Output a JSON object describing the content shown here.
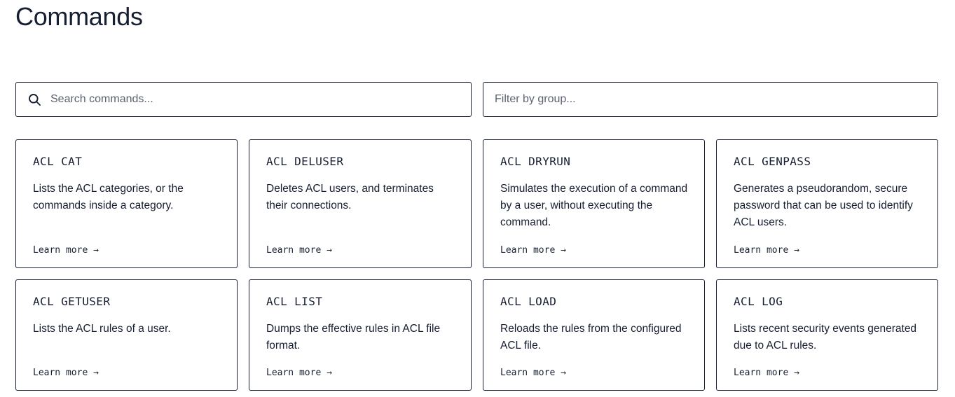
{
  "page": {
    "title": "Commands"
  },
  "search": {
    "commands_placeholder": "Search commands...",
    "group_placeholder": "Filter by group..."
  },
  "icons": {
    "search": "search-icon"
  },
  "colors": {
    "text": "#161f31",
    "border": "#161f31",
    "placeholder": "#5b6270",
    "background": "#ffffff"
  },
  "cards": [
    {
      "title": "ACL CAT",
      "description": "Lists the ACL categories, or the commands inside a category.",
      "link": "Learn more →"
    },
    {
      "title": "ACL DELUSER",
      "description": "Deletes ACL users, and terminates their connections.",
      "link": "Learn more →"
    },
    {
      "title": "ACL DRYRUN",
      "description": "Simulates the execution of a command by a user, without executing the command.",
      "link": "Learn more →"
    },
    {
      "title": "ACL GENPASS",
      "description": "Generates a pseudorandom, secure password that can be used to identify ACL users.",
      "link": "Learn more →"
    },
    {
      "title": "ACL GETUSER",
      "description": "Lists the ACL rules of a user.",
      "link": "Learn more →"
    },
    {
      "title": "ACL LIST",
      "description": "Dumps the effective rules in ACL file format.",
      "link": "Learn more →"
    },
    {
      "title": "ACL LOAD",
      "description": "Reloads the rules from the configured ACL file.",
      "link": "Learn more →"
    },
    {
      "title": "ACL LOG",
      "description": "Lists recent security events generated due to ACL rules.",
      "link": "Learn more →"
    }
  ]
}
